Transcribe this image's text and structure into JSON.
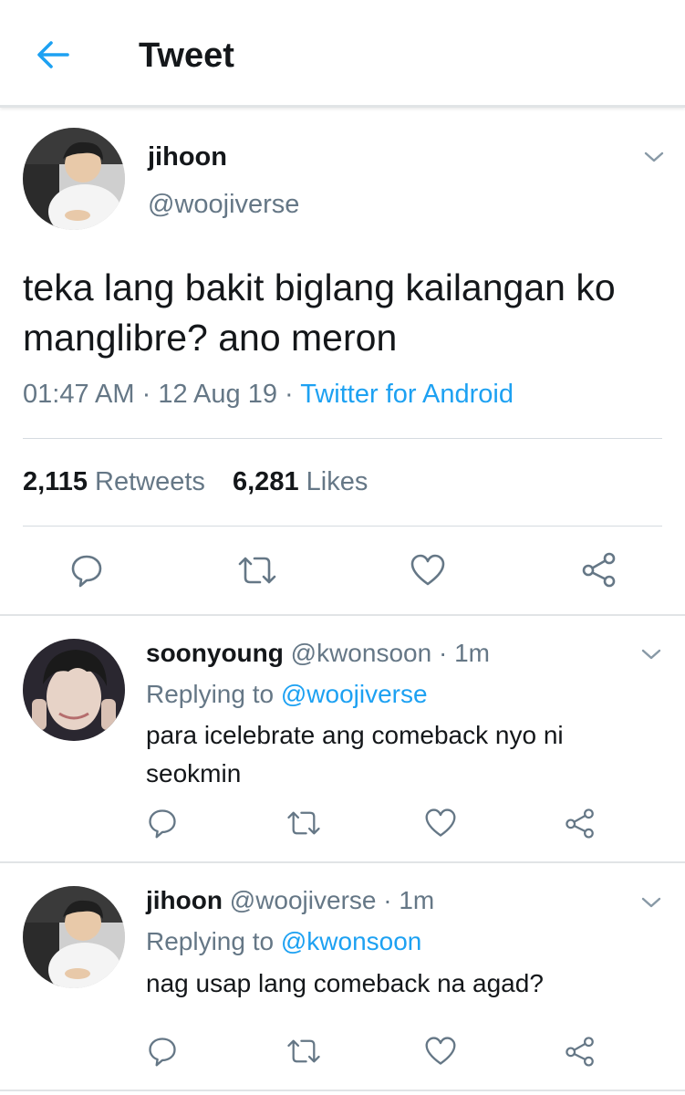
{
  "header": {
    "title": "Tweet"
  },
  "main_tweet": {
    "name": "jihoon",
    "handle": "@woojiverse",
    "text": "teka lang bakit biglang kailangan ko manglibre? ano meron",
    "time": "01:47 AM",
    "date": "12 Aug 19",
    "source": "Twitter for Android",
    "retweets_count": "2,115",
    "retweets_label": "Retweets",
    "likes_count": "6,281",
    "likes_label": "Likes"
  },
  "replies": [
    {
      "name": "soonyoung",
      "handle": "@kwonsoon",
      "time": "1m",
      "replying_label": "Replying to",
      "replying_to": "@woojiverse",
      "text": "para icelebrate ang comeback nyo ni seokmin"
    },
    {
      "name": "jihoon",
      "handle": "@woojiverse",
      "time": "1m",
      "replying_label": "Replying to",
      "replying_to": "@kwonsoon",
      "text": "nag usap lang comeback na agad?"
    }
  ],
  "separator": "·",
  "colors": {
    "accent": "#1da1f2",
    "secondary_text": "#657786",
    "primary_text": "#14171a",
    "icon": "#8899a6"
  },
  "icons": [
    "back-arrow-icon",
    "chevron-down-icon",
    "reply-icon",
    "retweet-icon",
    "like-icon",
    "share-icon"
  ]
}
